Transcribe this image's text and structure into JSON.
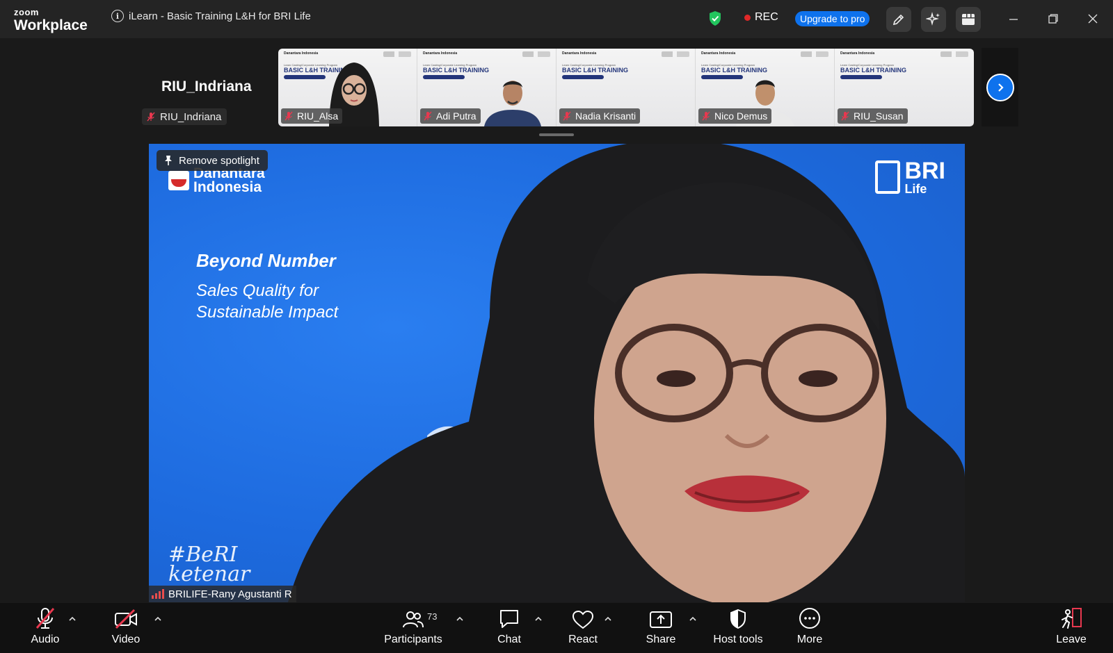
{
  "titlebar": {
    "logo_small": "zoom",
    "logo_large": "Workplace",
    "meeting_title": "iLearn - Basic Training L&H for BRI Life",
    "rec_label": "REC",
    "upgrade_label": "Upgrade to pro"
  },
  "gallery": {
    "active_speaker": "RIU_Indriana",
    "self_label": "RIU_Indriana",
    "thumb_banner_org": "Danantara Indonesia",
    "thumb_banner_sub": "Learn Casting/Corporate Learning Program",
    "thumb_banner_title": "BASIC L&H TRAINING",
    "participants": [
      {
        "name": "RIU_Alsa"
      },
      {
        "name": "Adi Putra"
      },
      {
        "name": "Nadia Krisanti"
      },
      {
        "name": "Nico Demus"
      },
      {
        "name": "RIU_Susan"
      }
    ]
  },
  "main_video": {
    "spotlight_button": "Remove spotlight",
    "logo_left": "Danantara\nIndonesia",
    "logo_right_main": "BRI",
    "logo_right_sub": "Life",
    "heading": "Beyond Number",
    "subheading": "Sales Quality for Sustainable Impact",
    "hashtag": "#BeRI\nketenar",
    "speaker_name": "BRILIFE-Rany Agustanti R"
  },
  "toolbar": {
    "audio": "Audio",
    "video": "Video",
    "participants": "Participants",
    "participants_count": "73",
    "chat": "Chat",
    "react": "React",
    "share": "Share",
    "host_tools": "Host tools",
    "more": "More",
    "leave": "Leave"
  },
  "colors": {
    "accent": "#0e72ed",
    "record": "#e02828",
    "muted": "#e8384f",
    "slide_blue": "#1d6ade"
  }
}
